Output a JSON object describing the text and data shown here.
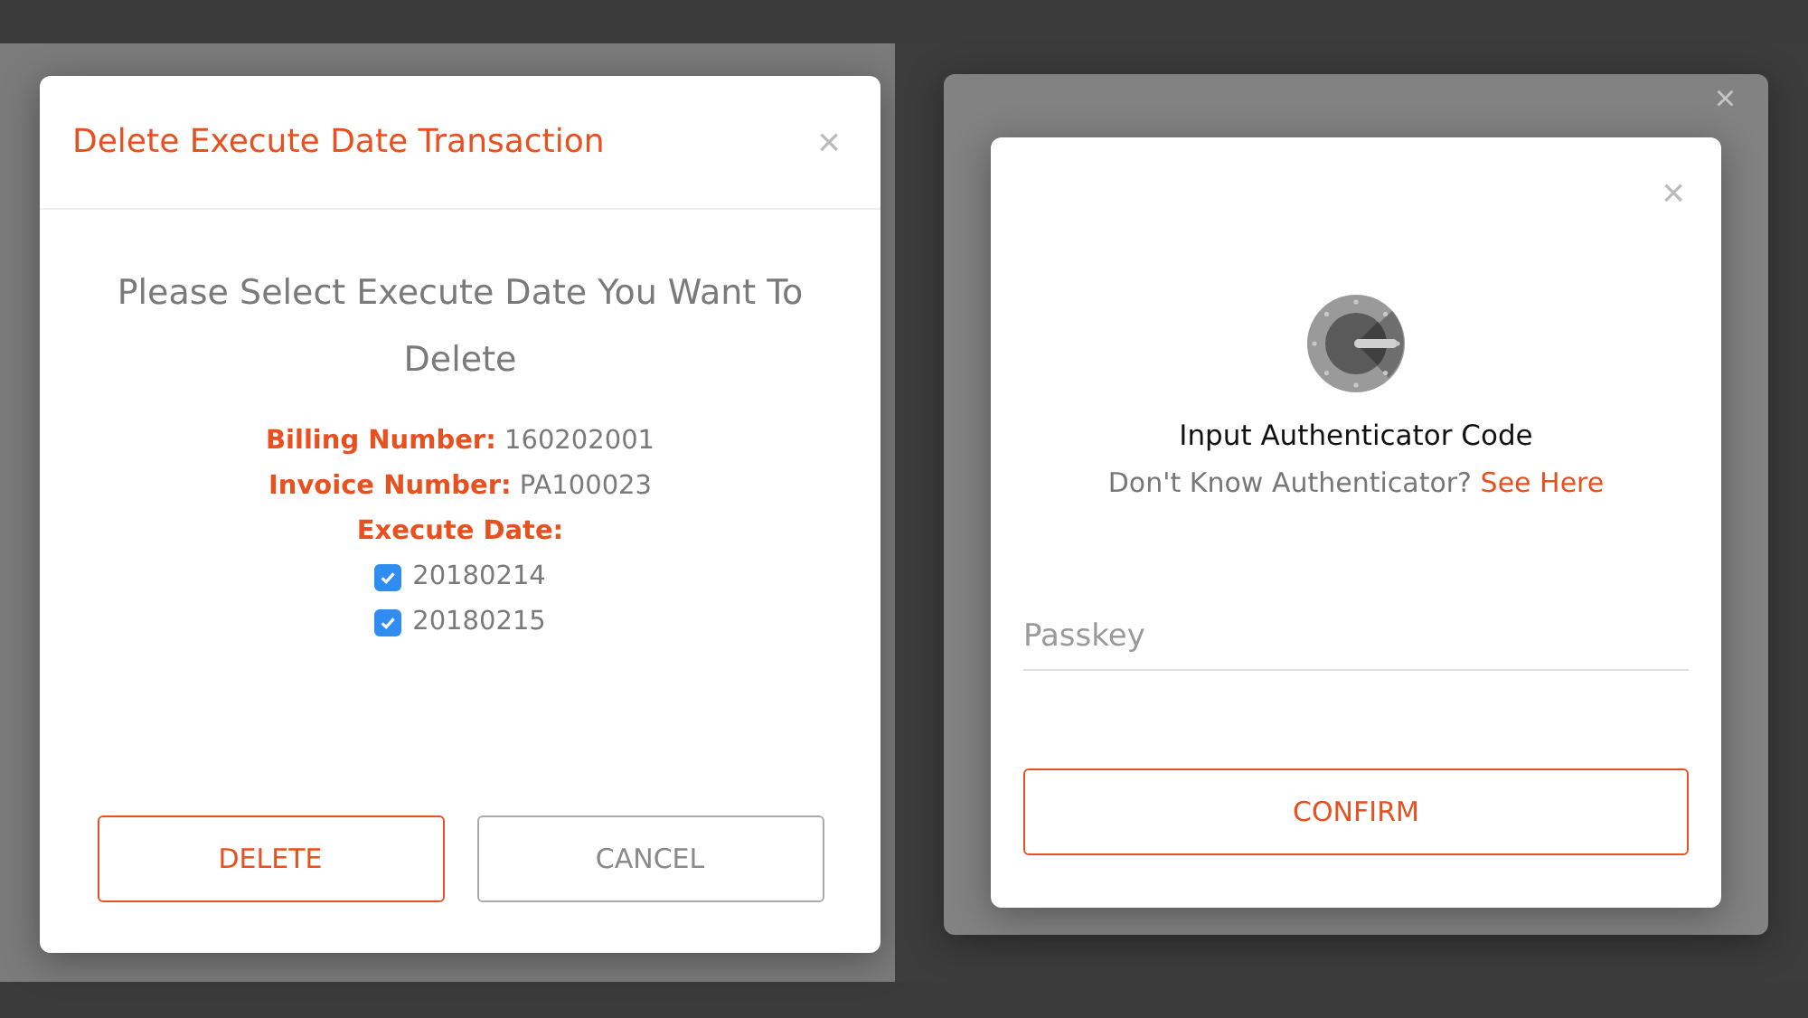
{
  "left_screen": {
    "dialog": {
      "title": "Delete Execute Date Transaction",
      "close": "×",
      "question": "Please Select Execute Date You Want To Delete",
      "fields": [
        {
          "label": "Billing Number:",
          "value": "160202001"
        },
        {
          "label": "Invoice Number:",
          "value": "PA100023"
        }
      ],
      "dates_label": "Execute Date:",
      "dates": [
        {
          "label": "20180214",
          "checked": true
        },
        {
          "label": "20180215",
          "checked": true
        }
      ],
      "buttons": [
        {
          "label": "DELETE",
          "kind": "primary"
        },
        {
          "label": "CANCEL",
          "kind": "secondary"
        }
      ]
    }
  },
  "right_screen": {
    "back_dialog": {
      "close": "×"
    },
    "dialog": {
      "close": "×",
      "title": "Input Authenticator Code",
      "help_text": "Don't Know Authenticator?",
      "help_link": "See Here",
      "passkey": {
        "placeholder": "Passkey"
      },
      "button": "CONFIRM"
    }
  }
}
